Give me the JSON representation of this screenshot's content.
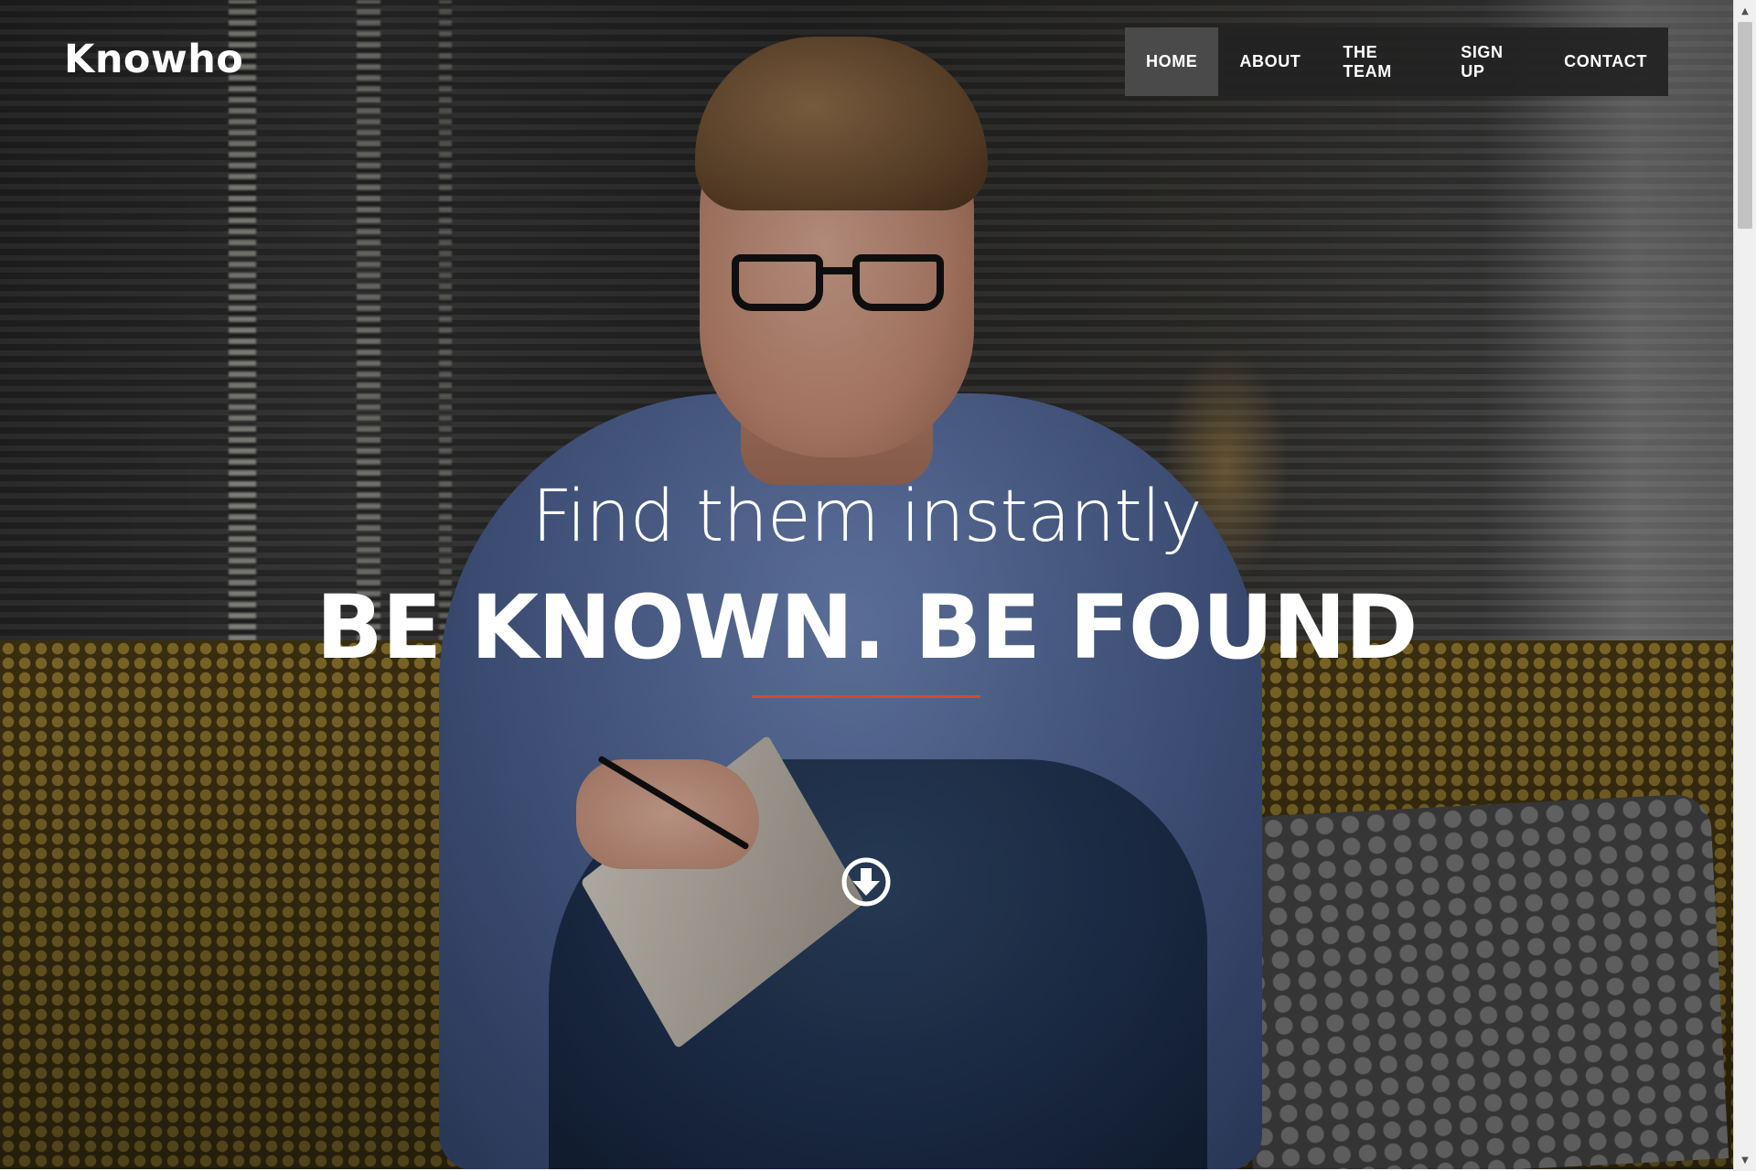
{
  "header": {
    "brand": "Knowho"
  },
  "nav": {
    "items": [
      {
        "label": "HOME",
        "active": true
      },
      {
        "label": "ABOUT",
        "active": false
      },
      {
        "label": "THE TEAM",
        "active": false
      },
      {
        "label": "SIGN UP",
        "active": false
      },
      {
        "label": "CONTACT",
        "active": false
      }
    ]
  },
  "hero": {
    "subtitle": "Find them instantly",
    "headline": "BE KNOWN. BE FOUND",
    "divider_color": "#d64a2a",
    "scroll_icon": "arrow-circle-down-icon"
  },
  "colors": {
    "nav_bg": "#222222",
    "nav_active_bg": "#4a4a4a",
    "text": "#ffffff",
    "accent": "#d64a2a"
  }
}
